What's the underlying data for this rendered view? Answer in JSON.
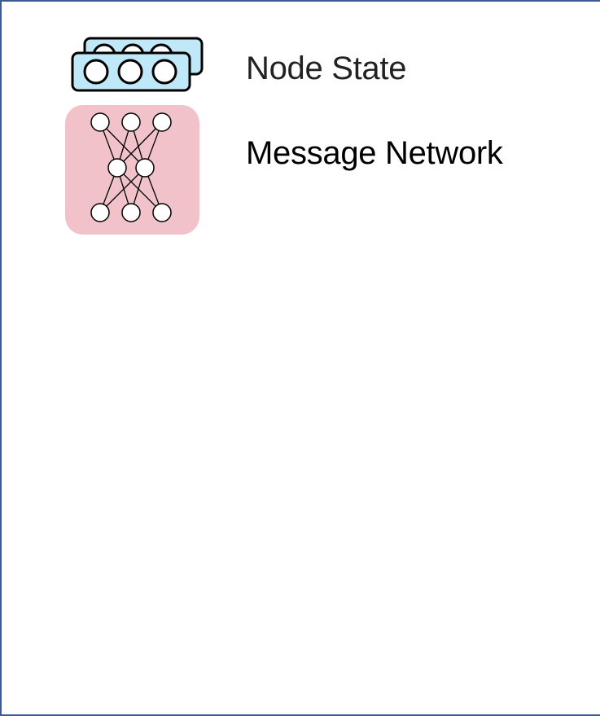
{
  "legend": {
    "items": [
      {
        "label": "Node State",
        "icon": "node-state-icon"
      },
      {
        "label": "Message Network",
        "icon": "neural-network-icon"
      }
    ]
  },
  "colors": {
    "node_state_fill": "#bfe8f8",
    "message_network_fill": "#f2c2ca",
    "frame_border": "#3c5a96",
    "node_fill": "#ffffff",
    "stroke": "#000000"
  }
}
